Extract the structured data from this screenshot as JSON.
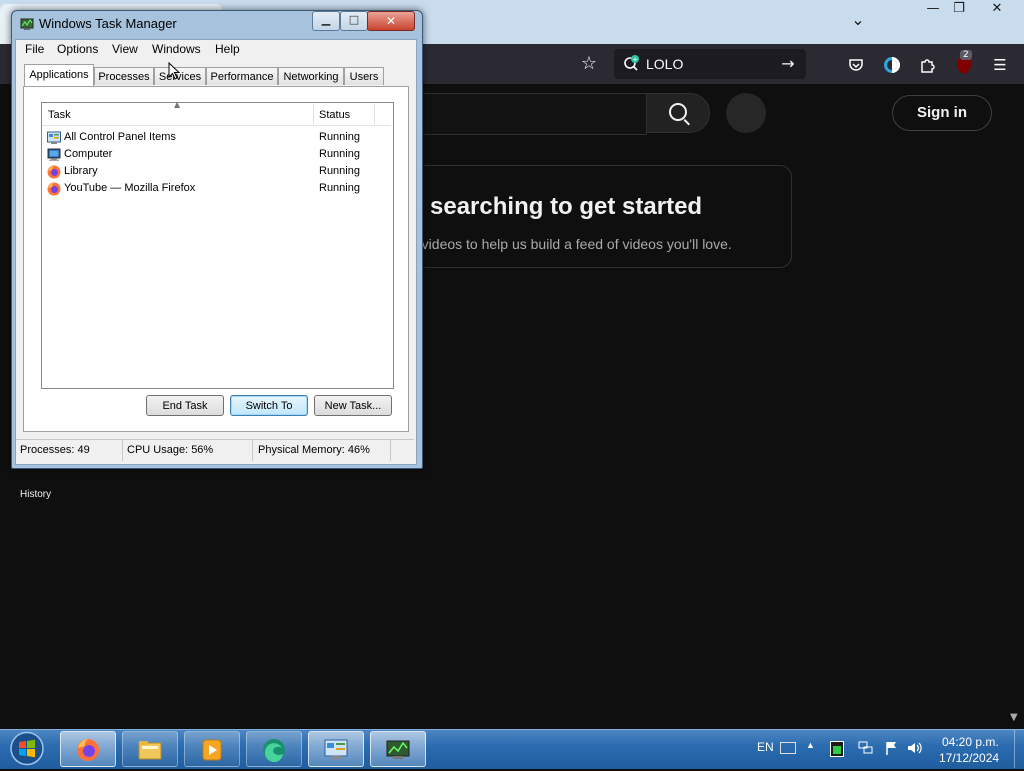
{
  "browser": {
    "search_text": "LOLO",
    "extension_badge": "2",
    "caption_buttons": [
      "—",
      "❐",
      "✕"
    ]
  },
  "youtube": {
    "sign_in": "Sign in",
    "card_title": "y searching to get started",
    "card_subtitle": "g videos to help us build a feed of videos you'll love.",
    "sidebar_history": "History"
  },
  "task_manager": {
    "title": "Windows Task Manager",
    "menu": [
      "File",
      "Options",
      "View",
      "Windows",
      "Help"
    ],
    "tabs": [
      "Applications",
      "Processes",
      "Services",
      "Performance",
      "Networking",
      "Users"
    ],
    "active_tab": "Applications",
    "columns": {
      "task": "Task",
      "status": "Status"
    },
    "rows": [
      {
        "task": "All Control Panel Items",
        "status": "Running",
        "icon": "control-panel-icon"
      },
      {
        "task": "Computer",
        "status": "Running",
        "icon": "computer-icon"
      },
      {
        "task": "Library",
        "status": "Running",
        "icon": "firefox-icon"
      },
      {
        "task": "YouTube — Mozilla Firefox",
        "status": "Running",
        "icon": "firefox-icon"
      }
    ],
    "buttons": {
      "end_task": "End Task",
      "switch_to": "Switch To",
      "new_task": "New Task..."
    },
    "status_bar": {
      "processes": "Processes: 49",
      "cpu": "CPU Usage: 56%",
      "memory": "Physical Memory: 46%"
    }
  },
  "taskbar": {
    "language": "EN",
    "time": "04:20 p.m.",
    "date": "17/12/2024",
    "apps": [
      "firefox",
      "windows-explorer",
      "media-player",
      "edge",
      "control-panel",
      "task-manager"
    ],
    "colors": {
      "taskbar": "#2b6cb0",
      "youtube_bg": "#0f0f0f"
    }
  }
}
